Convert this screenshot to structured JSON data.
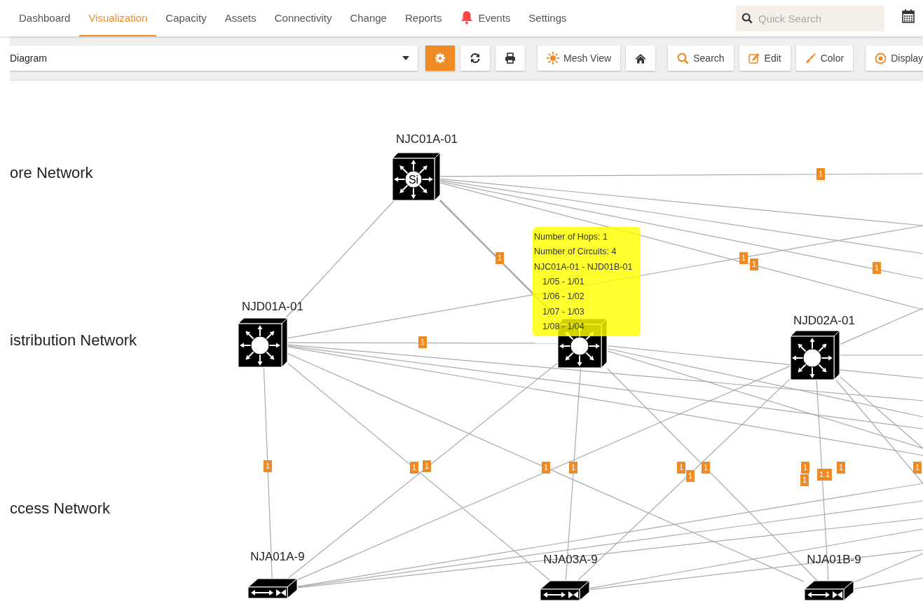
{
  "nav": {
    "tabs": [
      {
        "label": "Dashboard",
        "selected": false,
        "kind": "plain"
      },
      {
        "label": "Visualization",
        "selected": true,
        "kind": "plain"
      },
      {
        "label": "Capacity",
        "selected": false,
        "kind": "plain"
      },
      {
        "label": "Assets",
        "selected": false,
        "kind": "plain"
      },
      {
        "label": "Connectivity",
        "selected": false,
        "kind": "plain"
      },
      {
        "label": "Change",
        "selected": false,
        "kind": "plain"
      },
      {
        "label": "Reports",
        "selected": false,
        "kind": "plain"
      },
      {
        "label": "Events",
        "selected": false,
        "kind": "alert"
      },
      {
        "label": "Settings",
        "selected": false,
        "kind": "plain"
      }
    ],
    "search": {
      "placeholder": "Quick Search"
    }
  },
  "toolbar": {
    "view_select": {
      "value": "Diagram"
    },
    "buttons": [
      {
        "kind": "settings",
        "active": true
      },
      {
        "kind": "refresh",
        "active": false
      },
      {
        "kind": "print",
        "active": false
      },
      {
        "kind": "mesh",
        "label": "Mesh View",
        "active": false
      },
      {
        "kind": "home",
        "active": false
      },
      {
        "kind": "search",
        "label": "Search",
        "active": false
      },
      {
        "kind": "edit",
        "label": "Edit",
        "active": false
      },
      {
        "kind": "color",
        "label": "Color",
        "active": false
      },
      {
        "kind": "display",
        "label": "Display",
        "active": false
      }
    ]
  },
  "diagram": {
    "layers": [
      "ore Network",
      "istribution Network",
      "ccess Network"
    ],
    "nodes": [
      {
        "name": "NJC01A-01",
        "kind": "core",
        "mark": "Si"
      },
      {
        "name": "NJD01A-01",
        "kind": "distribution"
      },
      {
        "kind": "distribution"
      },
      {
        "name": "NJD02A-01",
        "kind": "distribution"
      },
      {
        "name": "NJA01A-9",
        "kind": "access"
      },
      {
        "name": "NJA03A-9",
        "kind": "access"
      },
      {
        "name": "NJA01B-9",
        "kind": "access"
      }
    ],
    "badges": [
      "1",
      "1",
      "1",
      "1",
      "1",
      "1",
      "1",
      "1",
      "1",
      "1",
      "1",
      "1",
      "1",
      "1",
      "1",
      "1",
      "1",
      "1",
      "1",
      "1"
    ],
    "tooltip": {
      "hops": "Number of Hops: 1",
      "circuits": "Number of Circuits: 4",
      "path": "NJC01A-01 - NJD01B-01",
      "ports": [
        "1/05 - 1/01",
        "1/06 - 1/02",
        "1/07 - 1/03",
        "1/08 - 1/04"
      ]
    }
  }
}
